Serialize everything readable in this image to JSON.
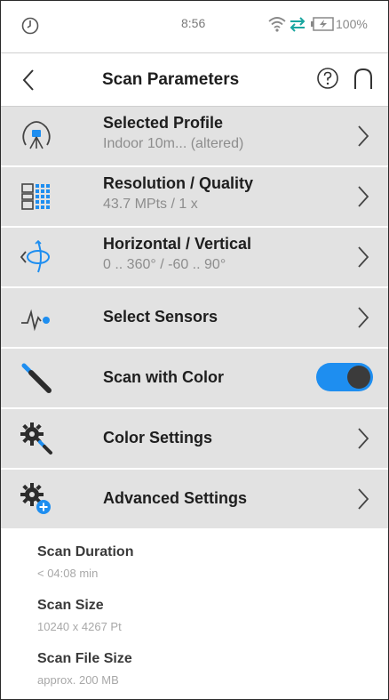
{
  "status_bar": {
    "time": "8:56",
    "battery": "100%"
  },
  "header": {
    "title": "Scan Parameters"
  },
  "rows": [
    {
      "label": "Selected Profile",
      "sub": "Indoor 10m... (altered)",
      "icon": "scanner-profile-icon"
    },
    {
      "label": "Resolution / Quality",
      "sub": "43.7 MPts / 1 x",
      "icon": "resolution-grid-icon"
    },
    {
      "label": "Horizontal / Vertical",
      "sub": "0 .. 360° / -60 .. 90°",
      "icon": "scan-range-icon"
    },
    {
      "label": "Select Sensors",
      "icon": "sensor-pulse-icon"
    },
    {
      "label": "Scan with Color",
      "icon": "color-pen-icon",
      "toggle": "on"
    },
    {
      "label": "Color Settings",
      "icon": "gear-pen-icon"
    },
    {
      "label": "Advanced Settings",
      "icon": "gear-plus-icon"
    }
  ],
  "info": [
    {
      "label": "Scan Duration",
      "value": "< 04:08 min"
    },
    {
      "label": "Scan Size",
      "value": "10240 x 4267 Pt"
    },
    {
      "label": "Scan File Size",
      "value": "approx. 200 MB"
    }
  ],
  "colors": {
    "accent": "#1e8ef0",
    "row_bg": "#e2e2e2",
    "text": "#1e1e1e",
    "muted": "#8d8d8d"
  }
}
